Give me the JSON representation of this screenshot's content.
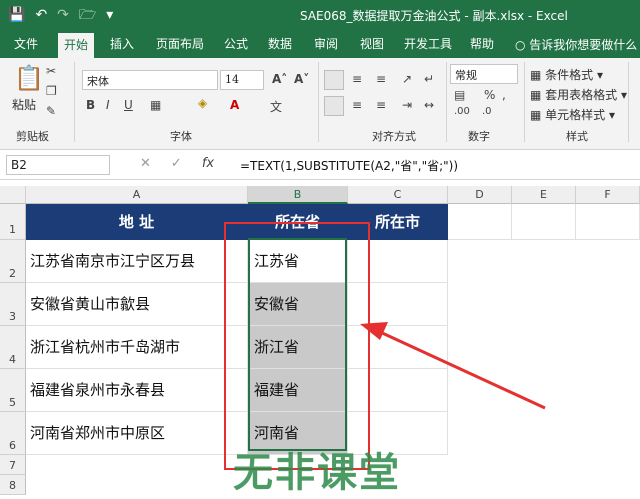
{
  "title_bar": {
    "window_title": "SAE068_数据提取万金油公式 - 副本.xlsx  -  Excel"
  },
  "menu": {
    "tabs": [
      "文件",
      "开始",
      "插入",
      "页面布局",
      "公式",
      "数据",
      "审阅",
      "视图",
      "开发工具",
      "帮助"
    ],
    "active_tab": "开始",
    "tell_me": "告诉我你想要做什么"
  },
  "ribbon": {
    "paste_label": "粘贴",
    "font_name": "宋体",
    "font_size": "14",
    "number_format": "常规",
    "styles": {
      "conditional": "条件格式",
      "table": "套用表格格式",
      "cell": "单元格样式"
    },
    "groups": {
      "clipboard": "剪贴板",
      "font": "字体",
      "alignment": "对齐方式",
      "number": "数字",
      "styles": "样式"
    }
  },
  "formula_bar": {
    "name_box": "B2",
    "fx": "fx",
    "formula": "=TEXT(1,SUBSTITUTE(A2,\"省\",\"省;\"))"
  },
  "sheet": {
    "columns": [
      "A",
      "B",
      "C",
      "D",
      "E",
      "F"
    ],
    "rows": [
      "1",
      "2",
      "3",
      "4",
      "5",
      "6",
      "7",
      "8"
    ],
    "header": {
      "a": "地      址",
      "b": "所在省",
      "c": "所在市"
    },
    "data": [
      {
        "address": "江苏省南京市江宁区万县",
        "province": "江苏省"
      },
      {
        "address": "安徽省黄山市歙县",
        "province": "安徽省"
      },
      {
        "address": "浙江省杭州市千岛湖市",
        "province": "浙江省"
      },
      {
        "address": "福建省泉州市永春县",
        "province": "福建省"
      },
      {
        "address": "河南省郑州市中原区",
        "province": "河南省"
      }
    ]
  },
  "watermark": "无非课堂",
  "colors": {
    "excel_green": "#217346",
    "header_blue": "#1b3c77",
    "annotation_red": "#e53030"
  }
}
